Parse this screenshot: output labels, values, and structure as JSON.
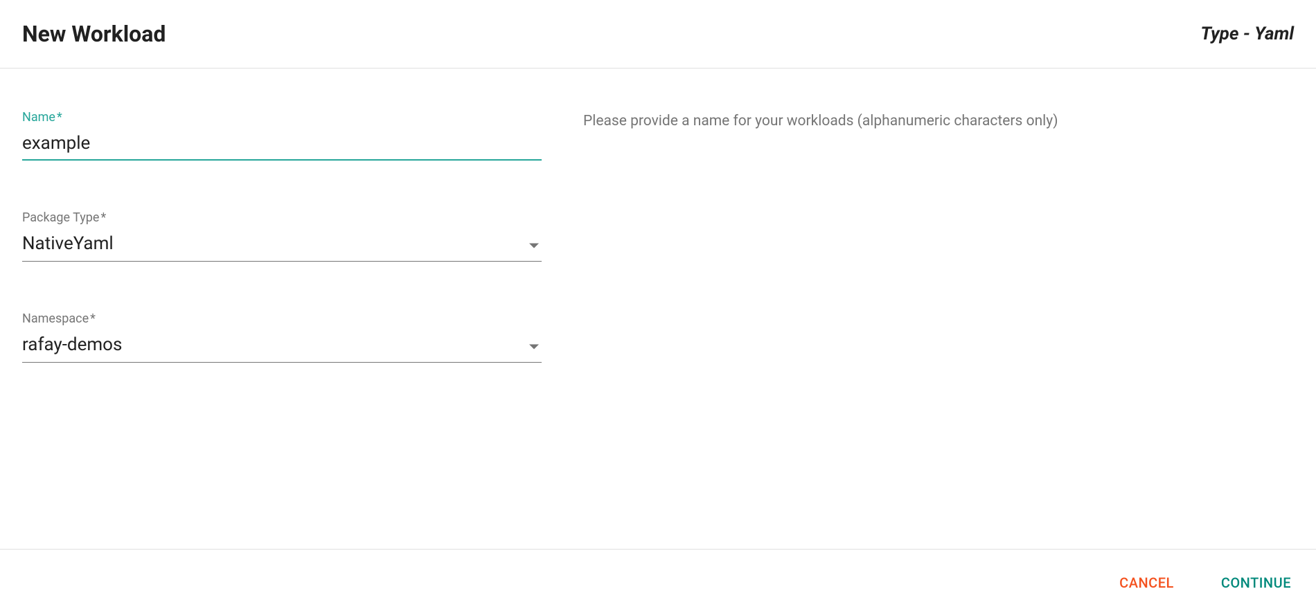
{
  "header": {
    "title": "New Workload",
    "type_label": "Type - Yaml"
  },
  "form": {
    "name": {
      "label": "Name",
      "required": "*",
      "value": "example"
    },
    "package_type": {
      "label": "Package Type",
      "required": "*",
      "value": "NativeYaml"
    },
    "namespace": {
      "label": "Namespace",
      "required": "*",
      "value": "rafay-demos"
    }
  },
  "help": {
    "name_help": "Please provide a name for your workloads (alphanumeric characters only)"
  },
  "footer": {
    "cancel_label": "CANCEL",
    "continue_label": "CONTINUE"
  }
}
